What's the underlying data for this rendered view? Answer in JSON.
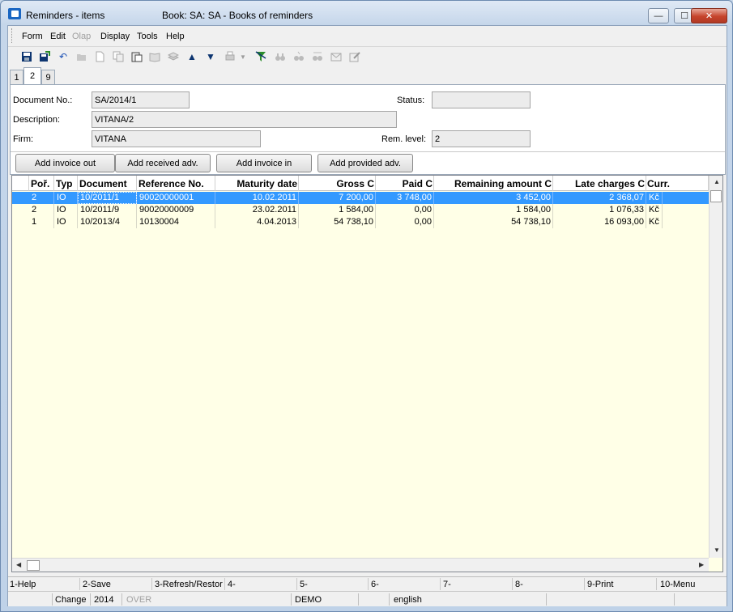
{
  "window": {
    "title": "Reminders - items",
    "subtitle": "Book: SA: SA - Books of reminders",
    "minimize": "—",
    "maximize": "☐",
    "close": "✕"
  },
  "menu": {
    "items": [
      "Form",
      "Edit",
      "Olap",
      "Display",
      "Tools",
      "Help"
    ],
    "disabled": [
      "Olap"
    ]
  },
  "tabs": [
    "1",
    "2",
    "9"
  ],
  "active_tab": "2",
  "form": {
    "document_no_label": "Document No.:",
    "document_no": "SA/2014/1",
    "status_label": "Status:",
    "status": "",
    "description_label": "Description:",
    "description": "VITANA/2",
    "firm_label": "Firm:",
    "firm": "VITANA",
    "rem_level_label": "Rem. level:",
    "rem_level": "2"
  },
  "buttons": {
    "add_invoice_out": "Add invoice out",
    "add_received_adv": "Add received adv.",
    "add_invoice_in": "Add invoice in",
    "add_provided_adv": "Add provided adv."
  },
  "grid": {
    "columns": [
      "Poř.",
      "Typ",
      "Document",
      "Reference No.",
      "Maturity date",
      "Gross C",
      "Paid C",
      "Remaining amount C",
      "Late charges C",
      "Curr."
    ],
    "rows": [
      [
        "2",
        "IO",
        "10/2011/1",
        "90020000001",
        "10.02.2011",
        "7 200,00",
        "3 748,00",
        "3 452,00",
        "2 368,07",
        "Kč"
      ],
      [
        "2",
        "IO",
        "10/2011/9",
        "90020000009",
        "23.02.2011",
        "1 584,00",
        "0,00",
        "1 584,00",
        "1 076,33",
        "Kč"
      ],
      [
        "1",
        "IO",
        "10/2013/4",
        "10130004",
        "4.04.2013",
        "54 738,10",
        "0,00",
        "54 738,10",
        "16 093,00",
        "Kč"
      ]
    ],
    "selected_row": 0
  },
  "fkeys": [
    "1-Help",
    "2-Save",
    "3-Refresh/Restor",
    "4-",
    "5-",
    "6-",
    "7-",
    "8-",
    "9-Print",
    "10-Menu"
  ],
  "status": {
    "mode": "Change",
    "year": "2014",
    "over": "OVER",
    "db": "DEMO",
    "language": "english"
  }
}
